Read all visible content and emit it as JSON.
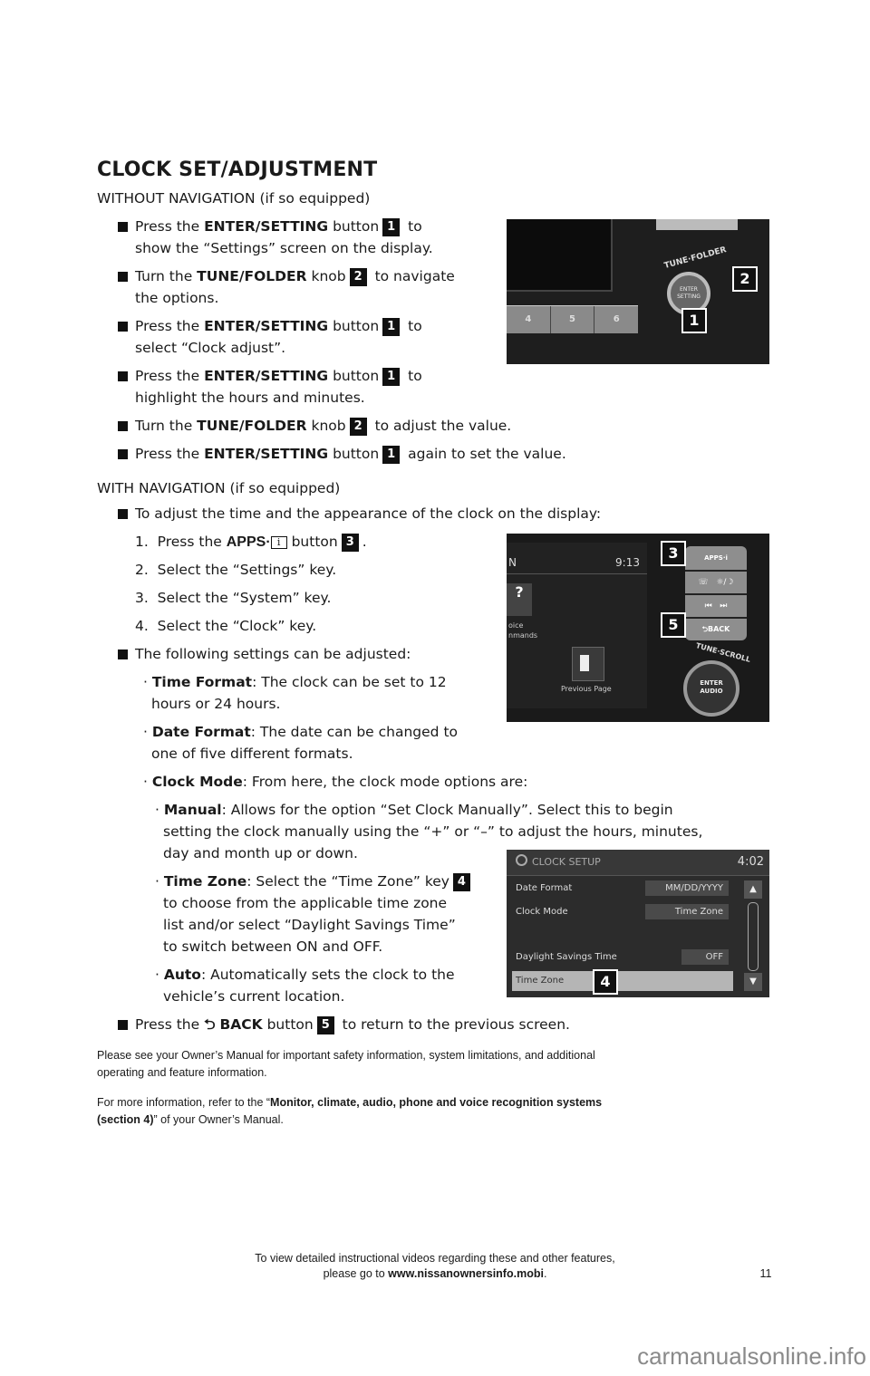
{
  "title": "CLOCK SET/ADJUSTMENT",
  "without_nav": {
    "heading": "WITHOUT NAVIGATION (if so equipped)",
    "steps": [
      {
        "pre": "Press the ",
        "bold": "ENTER/SETTING",
        "mid": " button",
        "num": "1",
        "post": " to",
        "line2": "show the “Settings” screen on the display."
      },
      {
        "pre": "Turn the ",
        "bold": "TUNE/FOLDER",
        "mid": " knob",
        "num": "2",
        "post": " to navigate",
        "line2": "the options."
      },
      {
        "pre": "Press the ",
        "bold": "ENTER/SETTING",
        "mid": " button",
        "num": "1",
        "post": " to",
        "line2": "select “Clock adjust”."
      },
      {
        "pre": "Press the ",
        "bold": "ENTER/SETTING",
        "mid": " button",
        "num": "1",
        "post": " to",
        "line2": "highlight the hours and minutes."
      },
      {
        "pre": "Turn the ",
        "bold": "TUNE/FOLDER",
        "mid": " knob",
        "num": "2",
        "post": " to adjust the value."
      },
      {
        "pre": "Press the ",
        "bold": "ENTER/SETTING",
        "mid": " button",
        "num": "1",
        "post": " again to set the value."
      }
    ]
  },
  "with_nav": {
    "heading": "WITH NAVIGATION (if so equipped)",
    "intro": "To adjust the time and the appearance of the clock on the display:",
    "numbered": [
      {
        "n": "1.",
        "pre": "Press the ",
        "apps": "APPS·",
        "icon": "i",
        "mid": " button",
        "num": "3",
        "post": "."
      },
      {
        "n": "2.",
        "text": "Select the “Settings” key."
      },
      {
        "n": "3.",
        "text": "Select the “System” key."
      },
      {
        "n": "4.",
        "text": "Select the “Clock” key."
      }
    ],
    "settings_intro": "The following settings can be adjusted:",
    "settings": [
      {
        "bold": "Time Format",
        "text": ": The clock can be set to 12",
        "line2": "hours or 24 hours."
      },
      {
        "bold": "Date Format",
        "text": ": The date can be changed to",
        "line2": "one of five different formats."
      },
      {
        "bold": "Clock Mode",
        "text": ": From here, the clock mode options are:"
      }
    ],
    "clock_modes": [
      {
        "bold": "Manual",
        "text": ": Allows for the option “Set Clock Manually”. Select this to begin",
        "line2": "setting the clock manually using the “+” or “–” to adjust the hours, minutes,",
        "line3": "day and month up or down."
      },
      {
        "bold": "Time Zone",
        "text": ": Select the “Time Zone” key",
        "num": "4",
        "line2": "to choose from the applicable time zone",
        "line3": "list and/or select “Daylight Savings Time”",
        "line4": "to switch between ON and OFF."
      },
      {
        "bold": "Auto",
        "text": ": Automatically sets the clock to the",
        "line2": "vehicle’s current location."
      }
    ],
    "back_step": {
      "pre": "Press the ",
      "bold": "BACK",
      "mid": " button",
      "num": "5",
      "post": " to return to the previous screen."
    }
  },
  "disclaimer": {
    "line1": "Please see your Owner’s Manual for important safety information, system limitations, and additional",
    "line2": "operating and feature information."
  },
  "more_info": {
    "pre": "For more information, refer to the “",
    "bold1": "Monitor, climate, audio, phone and voice recognition systems",
    "bold2": "(section 4)",
    "post": "” of your Owner’s Manual."
  },
  "photo1": {
    "knob_label": "TUNE·FOLDER",
    "button_label_1": "ENTER",
    "button_label_2": "SETTING",
    "presets": [
      "4",
      "5",
      "6"
    ],
    "callouts": [
      "2",
      "1"
    ]
  },
  "photo2": {
    "clock": "9:13",
    "screen_left_1": "oice",
    "screen_left_2": "nmands",
    "prev_page": "Previous Page",
    "apps_btn": "APPS·i",
    "back_btn": "⮌BACK",
    "knob_label": "TUNE·SCROLL",
    "enter_1": "ENTER",
    "enter_2": "AUDIO",
    "callouts": [
      "3",
      "5"
    ]
  },
  "photo3": {
    "header": "CLOCK SETUP",
    "clock": "4:02",
    "rows": [
      {
        "label": "Date Format",
        "value": "MM/DD/YYYY"
      },
      {
        "label": "Clock Mode",
        "value": "Time Zone"
      },
      {
        "label": "",
        "value": ""
      },
      {
        "label": "Daylight Savings Time",
        "value": "OFF"
      },
      {
        "label": "Time Zone",
        "value": ""
      }
    ],
    "callout": "4"
  },
  "footer": {
    "line1": "To view detailed instructional videos regarding these and other features,",
    "line2_pre": "please go to ",
    "line2_bold": "www.nissanownersinfo.mobi",
    "line2_post": ".",
    "page_number": "11"
  },
  "watermark": "carmanualsonline.info"
}
